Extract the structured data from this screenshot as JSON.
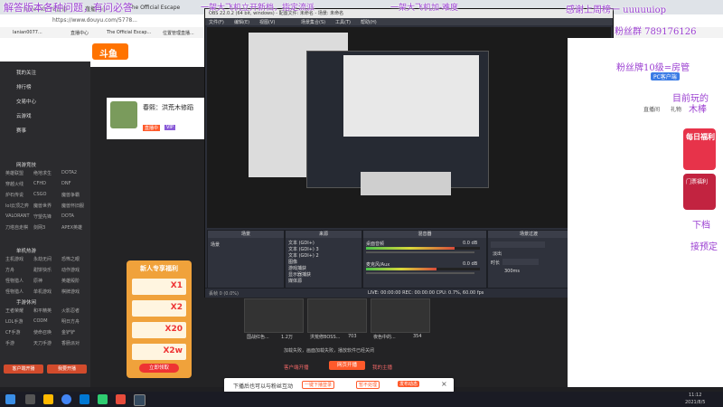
{
  "browser": {
    "tabs": [
      "lenient0778直播",
      "直播中心",
      "The Official Escape",
      "位置管理直播间",
      "新建标签页"
    ],
    "url": "https://www.douyu.com/5778...",
    "bookmarks": [
      "lanian0077...",
      "直播中心",
      "The Official Escap...",
      "位置管理直播..."
    ]
  },
  "overlay": {
    "top_left": "解答版本各种问题，有问必答",
    "top_center": "一架大飞机立开新档，指定流派",
    "top_center2": "一架大飞机加-难度",
    "top_right": "感谢上周榜一 uuuuuiop",
    "fan_group": "粉丝群 789176126",
    "fan_badge": "粉丝牌10级=房管",
    "current_game": "目前玩的",
    "current_game2": "木棒",
    "next_save": "下档",
    "next_plan": "接预定"
  },
  "site": {
    "logo": "斗鱼",
    "header_nav": [
      "首页",
      "直播",
      "分"
    ],
    "count_stat": "12",
    "room_title": "春熙：洪荒木修蹈",
    "room_tags": [
      "直播中",
      "VIP"
    ],
    "follow_count": "金币"
  },
  "sidebar": {
    "items": [
      "我的关注",
      "排行榜",
      "交易中心",
      "云游戏",
      "赛事"
    ],
    "section_online": "网游竞技",
    "online_games": [
      "英雄联盟",
      "绝地求生",
      "DOTA2",
      "穿越火线",
      "CFHD",
      "DNF",
      "炉石传说",
      "CSGO",
      "魔兽争霸",
      "lol云顶之弈",
      "魔兽世界",
      "魔兽怀旧服",
      "VALORANT",
      "守望先锋",
      "DOTA",
      "刀塔自走棋",
      "剑网3",
      "APEX英雄"
    ],
    "section_single": "单机热游",
    "single_games": [
      "主机游戏",
      "永劫无间",
      "恐怖之眼",
      "方舟",
      "甜饼快乐",
      "动作游戏",
      "怪物猎人",
      "原神",
      "英雄殿阶",
      "怪物猎人",
      "单机游戏",
      "棋牌游戏"
    ],
    "section_mobile": "手游休闲",
    "mobile_games": [
      "王者荣耀",
      "和平精英",
      "火影忍者",
      "LOL手游",
      "CODM",
      "明日方舟",
      "CF手游",
      "使命召唤",
      "金铲铲",
      "手游",
      "天刀手游",
      "香肠派对"
    ],
    "bottom_buttons": [
      "客户端开播",
      "我要开播"
    ]
  },
  "promo": {
    "title": "新人专享福利",
    "rewards": [
      "X1",
      "X2",
      "X20",
      "X2w"
    ],
    "cta": "立即领取"
  },
  "obs": {
    "title": "OBS 22.0.2 (64 bit, windows) - 配置文件: 未命名 - 场景: 未命名",
    "menu": [
      "文件(F)",
      "编辑(E)",
      "视图(V)",
      "场景集合(S)",
      "工具(T)",
      "帮助(H)"
    ],
    "docks": [
      "场景",
      "来源",
      "混音器",
      "场景过渡",
      "控件"
    ],
    "scenes": [
      "场景"
    ],
    "sources": [
      "文本 (GDI+)",
      "文本 (GDI+) 3",
      "文本 (GDI+) 2",
      "图像",
      "游戏捕获",
      "显示器捕获",
      "媒体源"
    ],
    "mixer": [
      {
        "name": "桌面音频",
        "level": "0.0 dB"
      },
      {
        "name": "麦克风/Aux",
        "level": "0.0 dB"
      }
    ],
    "mixer_fill": [
      0.78,
      0.62
    ],
    "transition": "淡出",
    "duration_label": "时长",
    "duration": "300ms",
    "controls": [
      "停止推流",
      "开始录制",
      "工作室模式",
      "设置",
      "退出"
    ],
    "status": "LIVE: 00:00:00   REC: 00:00:00   CPU: 0.7%, 60.00 fps",
    "status_dropped": "丢帧 0 (0.0%)"
  },
  "thumbs": [
    {
      "title": "国战红色...",
      "views": "1.2万"
    },
    {
      "title": "洪荒修BOSS...",
      "views": "703"
    },
    {
      "title": "夜色中的...",
      "views": "354"
    }
  ],
  "stream_status": "加载失败，画面加载失败，播放软件已经关闭",
  "stream_buttons": [
    "客户端开播",
    "网页开播",
    "我的主播"
  ],
  "notice": {
    "text": "下播后也可以与粉丝互动",
    "btn1": "一键下播登录",
    "btn2": "暂不处理",
    "btn3": "发布动态"
  },
  "right_panel": {
    "tabs": [
      "直播间",
      "礼物"
    ],
    "badge": "PC客户端",
    "gift_label": "每日福利",
    "gift_label2": "门票福利"
  },
  "taskbar": {
    "time": "2021/8/5",
    "clock": "11:12"
  }
}
